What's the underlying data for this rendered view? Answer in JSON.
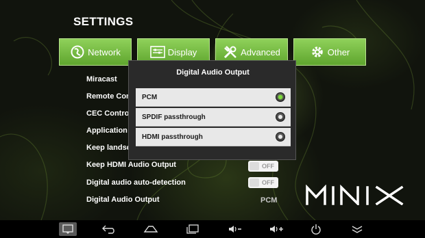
{
  "screen_title": "SETTINGS",
  "tabs": [
    {
      "label": "Network",
      "icon": "globe-icon"
    },
    {
      "label": "Display",
      "icon": "display-icon"
    },
    {
      "label": "Advanced",
      "icon": "tools-icon"
    },
    {
      "label": "Other",
      "icon": "gear-icon"
    }
  ],
  "settings": {
    "rows": [
      {
        "label": "Miracast"
      },
      {
        "label": "Remote Control"
      },
      {
        "label": "CEC Control"
      },
      {
        "label": "Application r"
      },
      {
        "label": "Keep landscape"
      },
      {
        "label": "Keep HDMI Audio Output",
        "toggle": "OFF"
      },
      {
        "label": "Digital audio auto-detection",
        "toggle": "OFF"
      },
      {
        "label": "Digital Audio Output",
        "value": "PCM"
      }
    ]
  },
  "dialog": {
    "title": "Digital Audio Output",
    "options": [
      {
        "label": "PCM",
        "selected": true
      },
      {
        "label": "SPDIF passthrough",
        "selected": false
      },
      {
        "label": "HDMI passthrough",
        "selected": false
      }
    ]
  },
  "brand_logo": "MINIX",
  "colors": {
    "tab_green": "#6fb83c",
    "radio_selected": "#7ddc3a",
    "dialog_bg": "#2a2a2a"
  },
  "navbar": {
    "icons": [
      "screenshot-icon",
      "back-icon",
      "home-icon",
      "recent-apps-icon",
      "volume-down-icon",
      "volume-up-icon",
      "power-icon",
      "hide-bar-icon"
    ]
  }
}
